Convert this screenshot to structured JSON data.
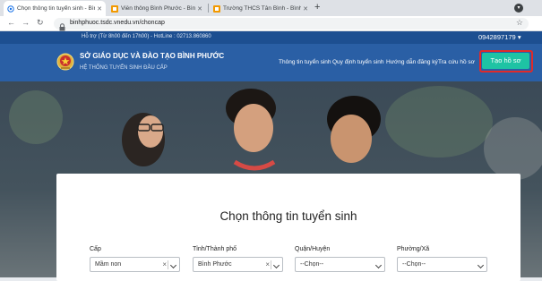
{
  "browser": {
    "tabs": [
      {
        "title": "Chọn thông tin tuyển sinh - Bình",
        "active": true
      },
      {
        "title": "Viễn thông Bình Phước - Bình Ph",
        "active": false
      },
      {
        "title": "Trường THCS Tân Bình - Bình Ph",
        "active": false
      }
    ],
    "new_tab": "+",
    "url": "binhphuoc.tsdc.vnedu.vn/choncap"
  },
  "site": {
    "hotline": "Hỗ trợ (Từ 8h00 đến 17h00) - HotLine : 02713.860860",
    "account": "0942897179",
    "account_caret": "▾",
    "org_name": "SỞ GIÁO DỤC VÀ ĐÀO TẠO BÌNH PHƯỚC",
    "org_sub": "HỆ THỐNG TUYỂN SINH ĐẦU CẤP",
    "nav": [
      "Thông tin tuyển sinh",
      "Quy định tuyển sinh",
      "Hướng dẫn đăng ký",
      "Tra cứu hồ sơ"
    ],
    "cta": "Tạo hồ sơ"
  },
  "form": {
    "title": "Chọn thông tin tuyển sinh",
    "fields": [
      {
        "label": "Cấp",
        "value": "Mầm non",
        "clearable": true
      },
      {
        "label": "Tỉnh/Thành phố",
        "value": "Bình Phước",
        "clearable": true
      },
      {
        "label": "Quận/Huyện",
        "value": "--Chọn--",
        "clearable": false
      },
      {
        "label": "Phường/Xã",
        "value": "--Chọn--",
        "clearable": false
      }
    ]
  },
  "colors": {
    "topbar": "#1d4f91",
    "header": "#2a5fa5",
    "cta": "#1ec3a4",
    "cta_outline": "#e02a2a"
  }
}
